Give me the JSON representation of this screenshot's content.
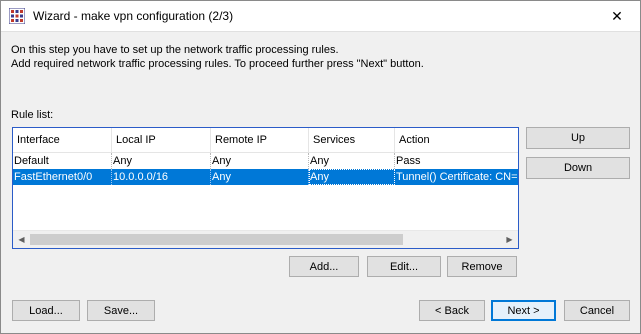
{
  "window": {
    "title": "Wizard - make vpn configuration (2/3)",
    "close_glyph": "✕"
  },
  "intro": {
    "line1": "On this step you have to set up the network traffic processing rules.",
    "line2": "Add required network traffic processing rules. To proceed further press \"Next\" button."
  },
  "rule_list": {
    "label": "Rule list:",
    "columns": [
      "Interface",
      "Local IP",
      "Remote IP",
      "Services",
      "Action"
    ],
    "rows": [
      [
        "Default",
        "Any",
        "Any",
        "Any",
        "Pass"
      ],
      [
        "FastEthernet0/0",
        "10.0.0.0/16",
        "Any",
        "Any",
        "Tunnel() Certificate: CN="
      ]
    ],
    "selected_row": 1
  },
  "side_buttons": {
    "up": "Up",
    "down": "Down"
  },
  "list_buttons": {
    "add": "Add...",
    "edit": "Edit...",
    "remove": "Remove"
  },
  "footer_buttons": {
    "load": "Load...",
    "save": "Save...",
    "back": "< Back",
    "next": "Next >",
    "cancel": "Cancel"
  },
  "colors": {
    "selection": "#0078d7",
    "list_border": "#2b5cc8"
  }
}
